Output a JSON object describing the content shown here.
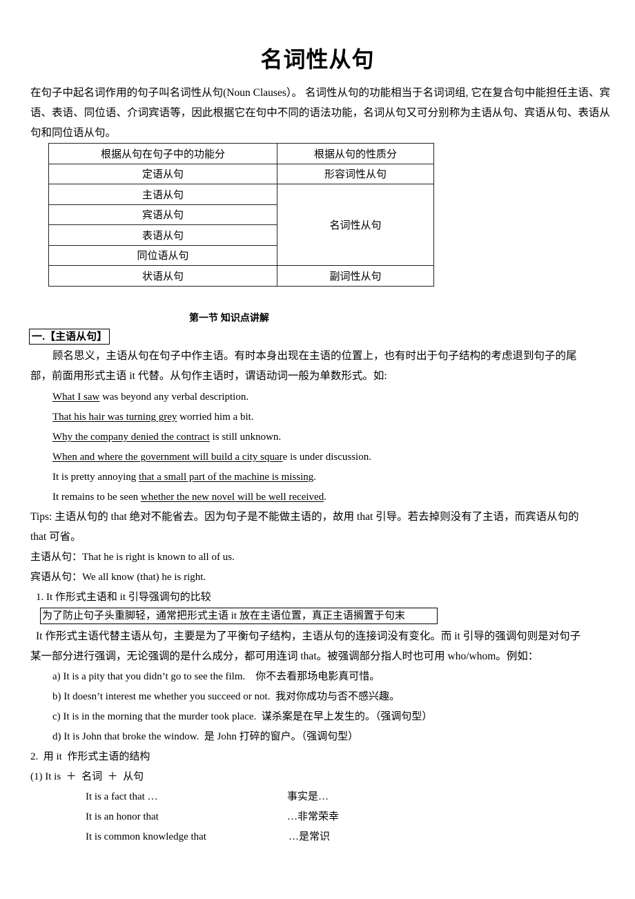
{
  "title": "名词性从句",
  "intro": "在句子中起名词作用的句子叫名词性从句(Noun Clauses）。 名词性从句的功能相当于名词词组, 它在复合句中能担任主语、宾语、表语、同位语、介词宾语等，因此根据它在句中不同的语法功能，名词从句又可分别称为主语从句、宾语从句、表语从句和同位语从句。",
  "table": {
    "headers": [
      "根据从句在句子中的功能分",
      "根据从句的性质分"
    ],
    "rows": [
      {
        "function": "定语从句",
        "nature": "形容词性从句"
      },
      {
        "function": "主语从句",
        "nature": "名词性从句"
      },
      {
        "function": "宾语从句"
      },
      {
        "function": "表语从句"
      },
      {
        "function": "同位语从句"
      },
      {
        "function": "状语从句",
        "nature": "副词性从句"
      }
    ]
  },
  "section_heading": "第一节  知识点讲解",
  "part1": {
    "heading": "一.【主语从句】",
    "explanation_line1": "顾名思义，主语从句在句子中作主语。有时本身出现在主语的位置上，也有时出于句子结构的考虑退到句子的尾",
    "explanation_line2": "部，前面用形式主语 it 代替。从句作主语时，谓语动词一般为单数形式。如:",
    "examples": [
      {
        "before": "",
        "underlined": "What I saw",
        "after": " was beyond any verbal description."
      },
      {
        "before": "",
        "underlined": "That his hair was turning grey",
        "after": " worried him a bit."
      },
      {
        "before": "",
        "underlined": "Why the company denied the contract",
        "after": " is still unknown."
      },
      {
        "before": "",
        "underlined": "When and where the government will build a city squar",
        "after": "e is under discussion."
      },
      {
        "before": "It is pretty annoying ",
        "underlined": "that a small part of the machine is missing",
        "after": "."
      },
      {
        "before": "It remains to be seen ",
        "underlined": "whether the new novel will be well received",
        "after": "."
      }
    ],
    "tips_line1": "Tips:  主语从句的 that 绝对不能省去。因为句子是不能做主语的，故用 that 引导。若去掉则没有了主语，而宾语从句的",
    "tips_line2": "that 可省。",
    "subject_example": "主语从句：That he is right is known to all of us.",
    "object_example": "宾语从句：We all know (that) he is right."
  },
  "point1": {
    "heading": "1. It  作形式主语和 it 引导强调句的比较",
    "boxed_note": "为了防止句子头重脚轻，通常把形式主语 it 放在主语位置，真正主语搁置于句末",
    "body_line1": "It  作形式主语代替主语从句，主要是为了平衡句子结构，主语从句的连接词没有变化。而 it 引导的强调句则是对句子",
    "body_line2": "某一部分进行强调，无论强调的是什么成分，都可用连词 that。被强调部分指人时也可用 who/whom。例如：",
    "examples": [
      "a) It is a pity that you didn’t go to see the film.    你不去看那场电影真可惜。",
      "b) It doesn’t interest me whether you succeed or not.  我对你成功与否不感兴趣。",
      "c) It is in the morning that the murder took place.  谋杀案是在早上发生的。（强调句型）",
      "d) It is John that broke the window.  是 John 打碎的窗户。（强调句型）"
    ]
  },
  "point2": {
    "heading": "2.  用 it  作形式主语的结构",
    "pattern": "(1) It is  ＋  名词  ＋  从句",
    "phrases": [
      {
        "en": "It is a fact that …",
        "zh": "事实是…"
      },
      {
        "en": "It is an honor that",
        "zh": "…非常荣幸"
      },
      {
        "en": "It is common knowledge that",
        "zh": "…是常识"
      }
    ]
  }
}
